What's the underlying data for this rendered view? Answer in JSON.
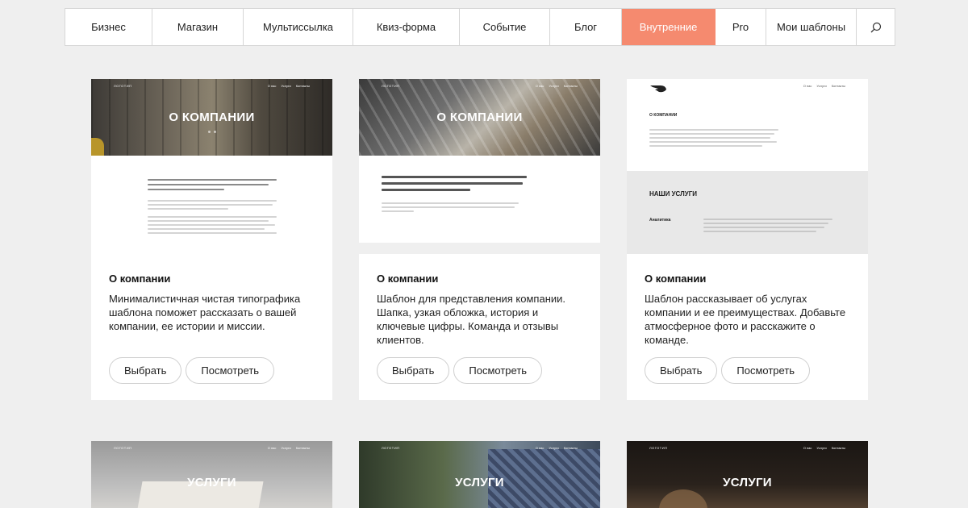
{
  "nav": {
    "items": [
      {
        "label": "Бизнес"
      },
      {
        "label": "Магазин"
      },
      {
        "label": "Мультиссылка"
      },
      {
        "label": "Квиз-форма"
      },
      {
        "label": "Событие"
      },
      {
        "label": "Блог"
      },
      {
        "label": "Внутренние",
        "active": true
      },
      {
        "label": "Pro"
      },
      {
        "label": "Мои шаблоны"
      }
    ],
    "search_icon": "search-icon"
  },
  "colors": {
    "accent": "#f58a6f",
    "background": "#efefef"
  },
  "cards": [
    {
      "preview": {
        "logo": "ЛОГОТИП",
        "menu": [
          "О нас",
          "Услуги",
          "Контакты"
        ],
        "hero_title": "О КОМПАНИИ"
      },
      "title": "О компании",
      "description": "Минималистичная чистая типографика шаблона поможет рассказать о вашей компании, ее истории и миссии.",
      "select_label": "Выбрать",
      "view_label": "Посмотреть"
    },
    {
      "preview": {
        "logo": "ЛОГОТИП",
        "menu": [
          "О нас",
          "Услуги",
          "Контакты"
        ],
        "hero_title": "О КОМПАНИИ"
      },
      "title": "О компании",
      "description": "Шаблон для представления компании. Шапка, узкая обложка, история и ключевые цифры. Команда и отзывы клиентов.",
      "select_label": "Выбрать",
      "view_label": "Посмотреть"
    },
    {
      "preview": {
        "menu": [
          "О нас",
          "Услуги",
          "Контакты"
        ],
        "heading_1": "О КОМПАНИИ",
        "heading_2": "НАШИ УСЛУГИ",
        "service_1": "Аналитика"
      },
      "title": "О компании",
      "description": "Шаблон рассказывает об услугах компании и ее преимуществах. Добавьте атмосферное фото и расскажите о команде.",
      "select_label": "Выбрать",
      "view_label": "Посмотреть"
    }
  ],
  "bottom_cards": [
    {
      "logo": "ЛОГОТИП",
      "menu": [
        "О нас",
        "Услуги",
        "Контакты"
      ],
      "hero_title": "УСЛУГИ"
    },
    {
      "logo": "ЛОГОТИП",
      "menu": [
        "О нас",
        "Услуги",
        "Контакты"
      ],
      "hero_title": "УСЛУГИ"
    },
    {
      "logo": "ЛОГОТИП",
      "menu": [
        "О нас",
        "Услуги",
        "Контакты"
      ],
      "hero_title": "УСЛУГИ"
    }
  ]
}
